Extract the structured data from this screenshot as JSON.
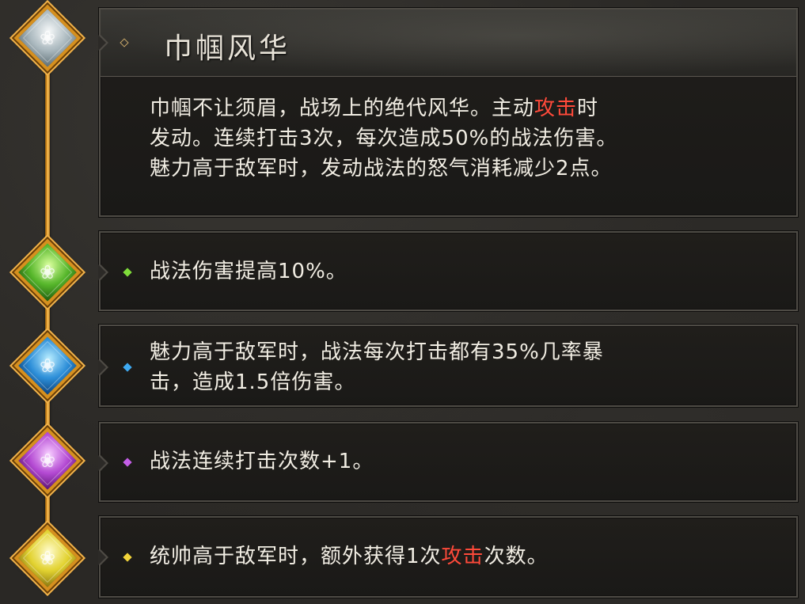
{
  "skill": {
    "title": "巾帼风华",
    "description": {
      "line1_a": "巾帼不让须眉，战场上的绝代风华。主动",
      "line1_hl": "攻击",
      "line1_b": "时",
      "line2": "发动。连续打击3次，每次造成50%的战法伤害。",
      "line3": "魅力高于敌军时，发动战法的怒气消耗减少2点。"
    }
  },
  "upgrades": [
    {
      "text": "战法伤害提高10%。",
      "color": "#7fdc3a",
      "gem": "green-gem-icon"
    },
    {
      "text_line1": "魅力高于敌军时，战法每次打击都有35%几率暴",
      "text_line2": "击，造成1.5倍伤害。",
      "color": "#3ea9f0",
      "gem": "blue-gem-icon"
    },
    {
      "text": "战法连续打击次数+1。",
      "color": "#c35ee6",
      "gem": "purple-gem-icon"
    },
    {
      "text_a": "统帅高于敌军时，额外获得1次",
      "text_hl": "攻击",
      "text_b": "次数。",
      "color": "#f2d43a",
      "gem": "yellow-gem-icon"
    }
  ],
  "highlight_color": "#ff4a3a"
}
